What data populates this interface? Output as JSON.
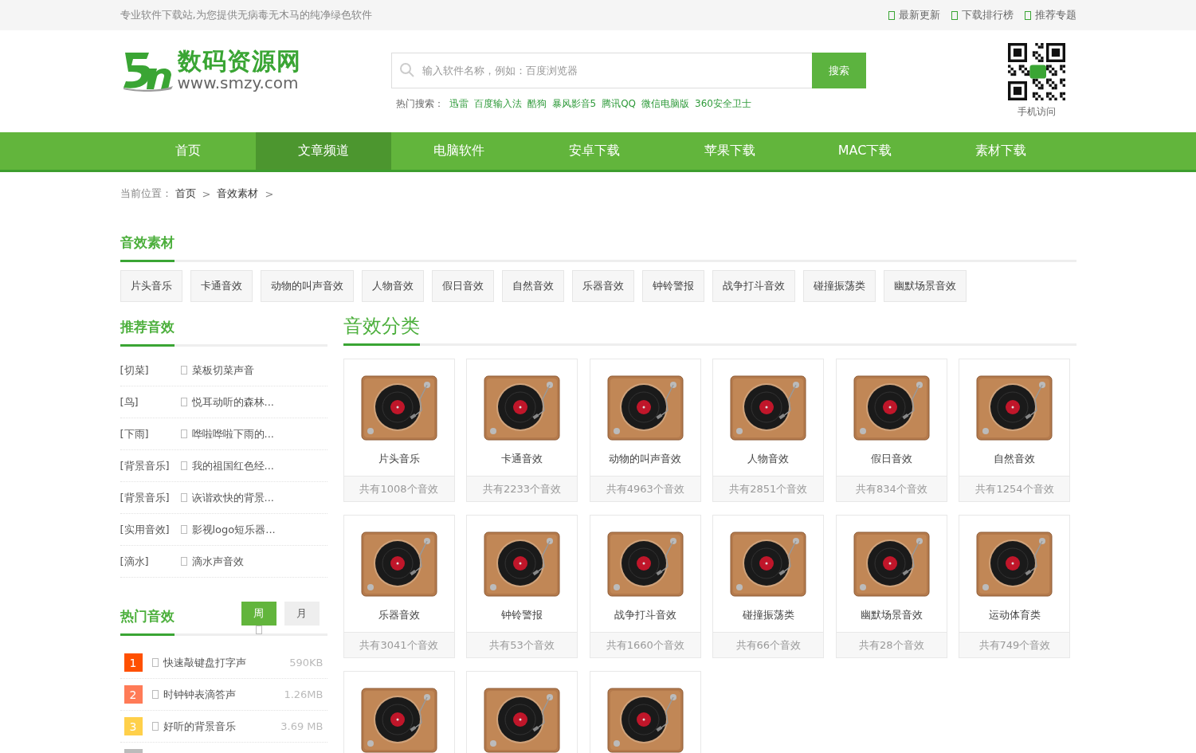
{
  "top_bar": {
    "slogan": "专业软件下载站,为您提供无病毒无木马的纯净绿色软件",
    "links": [
      "最新更新",
      "下载排行榜",
      "推荐专题"
    ]
  },
  "header": {
    "logo": {
      "title": "数码资源网",
      "url": "www.smzy.com"
    },
    "search": {
      "placeholder": "输入软件名称，例如：百度浏览器",
      "button": "搜索"
    },
    "hot_label": "热门搜索：",
    "hot_searches": [
      "迅雷",
      "百度输入法",
      "酷狗",
      "暴风影音5",
      "腾讯QQ",
      "微信电脑版",
      "360安全卫士"
    ],
    "qr_caption": "手机访问"
  },
  "nav": [
    {
      "label": "首页",
      "selected": false
    },
    {
      "label": "文章频道",
      "selected": true
    },
    {
      "label": "电脑软件",
      "selected": false
    },
    {
      "label": "安卓下载",
      "selected": false
    },
    {
      "label": "苹果下载",
      "selected": false
    },
    {
      "label": "MAC下载",
      "selected": false
    },
    {
      "label": "素材下载",
      "selected": false
    }
  ],
  "breadcrumb": {
    "label": "当前位置：",
    "items": [
      {
        "text": "首页",
        "sep": ">"
      },
      {
        "text": "音效素材",
        "sep": ">"
      }
    ]
  },
  "category_section": {
    "title": "音效素材",
    "tags": [
      "片头音乐",
      "卡通音效",
      "动物的叫声音效",
      "人物音效",
      "假日音效",
      "自然音效",
      "乐器音效",
      "钟铃警报",
      "战争打斗音效",
      "碰撞振荡类",
      "幽默场景音效"
    ]
  },
  "recommended": {
    "title": "推荐音效",
    "items": [
      {
        "tag": "[切菜]",
        "title": "菜板切菜声音"
      },
      {
        "tag": "[鸟]",
        "title": "悦耳动听的森林..."
      },
      {
        "tag": "[下雨]",
        "title": "哗啦哗啦下雨的..."
      },
      {
        "tag": "[背景音乐]",
        "title": "我的祖国红色经..."
      },
      {
        "tag": "[背景音乐]",
        "title": "诙谐欢快的背景..."
      },
      {
        "tag": "[实用音效]",
        "title": "影视logo短乐器..."
      },
      {
        "tag": "[滴水]",
        "title": "滴水声音效"
      }
    ]
  },
  "hot": {
    "title": "热门音效",
    "tabs": [
      {
        "label": "周",
        "selected": true
      },
      {
        "label": "月",
        "selected": false
      }
    ],
    "items": [
      {
        "rank": "1",
        "title": "快速敲键盘打字声",
        "size": "590KB",
        "color": "#ff5000"
      },
      {
        "rank": "2",
        "title": "时钟钟表滴答声",
        "size": "1.26MB",
        "color": "#ff7b57"
      },
      {
        "rank": "3",
        "title": "好听的背景音乐",
        "size": "3.69 MB",
        "color": "#ffd04a"
      },
      {
        "color": "#bbbbbb"
      }
    ]
  },
  "main": {
    "title": "音效分类",
    "cards": [
      {
        "name": "片头音乐",
        "count": "共有1008个音效"
      },
      {
        "name": "卡通音效",
        "count": "共有2233个音效"
      },
      {
        "name": "动物的叫声音效",
        "count": "共有4963个音效"
      },
      {
        "name": "人物音效",
        "count": "共有2851个音效"
      },
      {
        "name": "假日音效",
        "count": "共有834个音效"
      },
      {
        "name": "自然音效",
        "count": "共有1254个音效"
      },
      {
        "name": "乐器音效",
        "count": "共有3041个音效"
      },
      {
        "name": "钟铃警报",
        "count": "共有53个音效"
      },
      {
        "name": "战争打斗音效",
        "count": "共有1660个音效"
      },
      {
        "name": "碰撞振荡类",
        "count": "共有66个音效"
      },
      {
        "name": "幽默场景音效",
        "count": "共有28个音效"
      },
      {
        "name": "运动体育类",
        "count": "共有749个音效"
      },
      {
        "kind": "cut"
      },
      {
        "kind": "cut"
      },
      {
        "kind": "cut"
      }
    ]
  }
}
